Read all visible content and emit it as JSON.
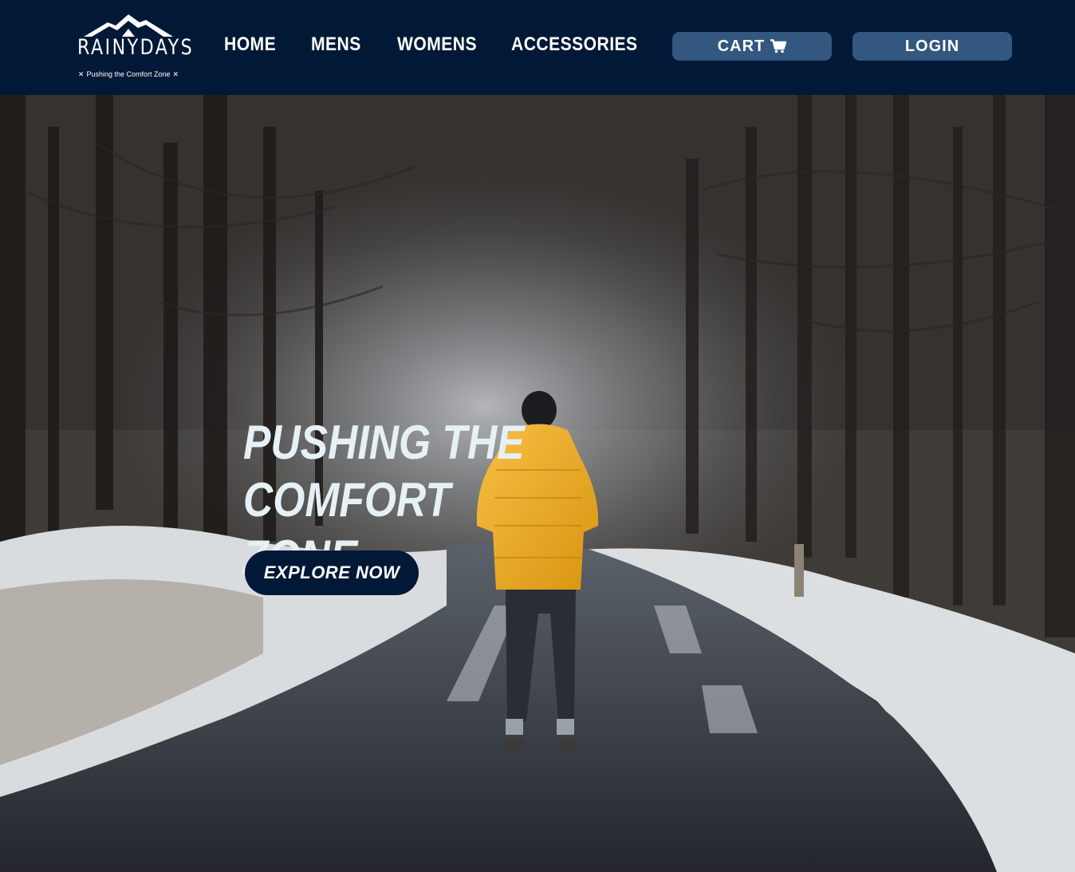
{
  "header": {
    "logo": {
      "brand": "RAINYDAYS",
      "tagline": "Pushing the Comfort Zone",
      "tagline_mark_left": "✕",
      "tagline_mark_right": "✕"
    },
    "nav": {
      "items": [
        {
          "label": "HOME"
        },
        {
          "label": "MENS"
        },
        {
          "label": "WOMENS"
        },
        {
          "label": "ACCESSORIES"
        }
      ]
    },
    "cart_label": "CART",
    "login_label": "LOGIN"
  },
  "hero": {
    "title_line1": "PUSHING THE COMFORT",
    "title_line2": "ZONE",
    "cta_label": "EXPLORE NOW"
  },
  "colors": {
    "header_bg": "#011936",
    "button_bg": "#33577f",
    "cta_bg": "#011936",
    "title_text": "#e6f1f6",
    "jacket": "#f2b023"
  },
  "icons": {
    "logo": "mountain-logo-icon",
    "cart": "shopping-cart-icon"
  }
}
